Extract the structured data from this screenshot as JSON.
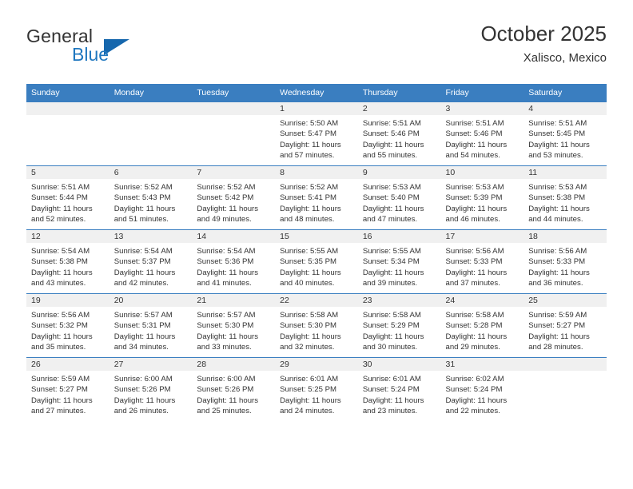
{
  "brand": {
    "name_part1": "General",
    "name_part2": "Blue",
    "logo_icon": "blue-triangle-logo"
  },
  "header": {
    "title": "October 2025",
    "subtitle": "Xalisco, Mexico"
  },
  "colors": {
    "header_blue": "#3a7ec0",
    "brand_blue": "#1f77bf",
    "day_band_grey": "#f0f0f0",
    "text": "#333333"
  },
  "weekdays": [
    "Sunday",
    "Monday",
    "Tuesday",
    "Wednesday",
    "Thursday",
    "Friday",
    "Saturday"
  ],
  "weeks": [
    [
      {
        "day": "",
        "sunrise": "",
        "sunset": "",
        "daylight1": "",
        "daylight2": "",
        "empty": true
      },
      {
        "day": "",
        "sunrise": "",
        "sunset": "",
        "daylight1": "",
        "daylight2": "",
        "empty": true
      },
      {
        "day": "",
        "sunrise": "",
        "sunset": "",
        "daylight1": "",
        "daylight2": "",
        "empty": true
      },
      {
        "day": "1",
        "sunrise": "Sunrise: 5:50 AM",
        "sunset": "Sunset: 5:47 PM",
        "daylight1": "Daylight: 11 hours",
        "daylight2": "and 57 minutes.",
        "empty": false
      },
      {
        "day": "2",
        "sunrise": "Sunrise: 5:51 AM",
        "sunset": "Sunset: 5:46 PM",
        "daylight1": "Daylight: 11 hours",
        "daylight2": "and 55 minutes.",
        "empty": false
      },
      {
        "day": "3",
        "sunrise": "Sunrise: 5:51 AM",
        "sunset": "Sunset: 5:46 PM",
        "daylight1": "Daylight: 11 hours",
        "daylight2": "and 54 minutes.",
        "empty": false
      },
      {
        "day": "4",
        "sunrise": "Sunrise: 5:51 AM",
        "sunset": "Sunset: 5:45 PM",
        "daylight1": "Daylight: 11 hours",
        "daylight2": "and 53 minutes.",
        "empty": false
      }
    ],
    [
      {
        "day": "5",
        "sunrise": "Sunrise: 5:51 AM",
        "sunset": "Sunset: 5:44 PM",
        "daylight1": "Daylight: 11 hours",
        "daylight2": "and 52 minutes.",
        "empty": false
      },
      {
        "day": "6",
        "sunrise": "Sunrise: 5:52 AM",
        "sunset": "Sunset: 5:43 PM",
        "daylight1": "Daylight: 11 hours",
        "daylight2": "and 51 minutes.",
        "empty": false
      },
      {
        "day": "7",
        "sunrise": "Sunrise: 5:52 AM",
        "sunset": "Sunset: 5:42 PM",
        "daylight1": "Daylight: 11 hours",
        "daylight2": "and 49 minutes.",
        "empty": false
      },
      {
        "day": "8",
        "sunrise": "Sunrise: 5:52 AM",
        "sunset": "Sunset: 5:41 PM",
        "daylight1": "Daylight: 11 hours",
        "daylight2": "and 48 minutes.",
        "empty": false
      },
      {
        "day": "9",
        "sunrise": "Sunrise: 5:53 AM",
        "sunset": "Sunset: 5:40 PM",
        "daylight1": "Daylight: 11 hours",
        "daylight2": "and 47 minutes.",
        "empty": false
      },
      {
        "day": "10",
        "sunrise": "Sunrise: 5:53 AM",
        "sunset": "Sunset: 5:39 PM",
        "daylight1": "Daylight: 11 hours",
        "daylight2": "and 46 minutes.",
        "empty": false
      },
      {
        "day": "11",
        "sunrise": "Sunrise: 5:53 AM",
        "sunset": "Sunset: 5:38 PM",
        "daylight1": "Daylight: 11 hours",
        "daylight2": "and 44 minutes.",
        "empty": false
      }
    ],
    [
      {
        "day": "12",
        "sunrise": "Sunrise: 5:54 AM",
        "sunset": "Sunset: 5:38 PM",
        "daylight1": "Daylight: 11 hours",
        "daylight2": "and 43 minutes.",
        "empty": false
      },
      {
        "day": "13",
        "sunrise": "Sunrise: 5:54 AM",
        "sunset": "Sunset: 5:37 PM",
        "daylight1": "Daylight: 11 hours",
        "daylight2": "and 42 minutes.",
        "empty": false
      },
      {
        "day": "14",
        "sunrise": "Sunrise: 5:54 AM",
        "sunset": "Sunset: 5:36 PM",
        "daylight1": "Daylight: 11 hours",
        "daylight2": "and 41 minutes.",
        "empty": false
      },
      {
        "day": "15",
        "sunrise": "Sunrise: 5:55 AM",
        "sunset": "Sunset: 5:35 PM",
        "daylight1": "Daylight: 11 hours",
        "daylight2": "and 40 minutes.",
        "empty": false
      },
      {
        "day": "16",
        "sunrise": "Sunrise: 5:55 AM",
        "sunset": "Sunset: 5:34 PM",
        "daylight1": "Daylight: 11 hours",
        "daylight2": "and 39 minutes.",
        "empty": false
      },
      {
        "day": "17",
        "sunrise": "Sunrise: 5:56 AM",
        "sunset": "Sunset: 5:33 PM",
        "daylight1": "Daylight: 11 hours",
        "daylight2": "and 37 minutes.",
        "empty": false
      },
      {
        "day": "18",
        "sunrise": "Sunrise: 5:56 AM",
        "sunset": "Sunset: 5:33 PM",
        "daylight1": "Daylight: 11 hours",
        "daylight2": "and 36 minutes.",
        "empty": false
      }
    ],
    [
      {
        "day": "19",
        "sunrise": "Sunrise: 5:56 AM",
        "sunset": "Sunset: 5:32 PM",
        "daylight1": "Daylight: 11 hours",
        "daylight2": "and 35 minutes.",
        "empty": false
      },
      {
        "day": "20",
        "sunrise": "Sunrise: 5:57 AM",
        "sunset": "Sunset: 5:31 PM",
        "daylight1": "Daylight: 11 hours",
        "daylight2": "and 34 minutes.",
        "empty": false
      },
      {
        "day": "21",
        "sunrise": "Sunrise: 5:57 AM",
        "sunset": "Sunset: 5:30 PM",
        "daylight1": "Daylight: 11 hours",
        "daylight2": "and 33 minutes.",
        "empty": false
      },
      {
        "day": "22",
        "sunrise": "Sunrise: 5:58 AM",
        "sunset": "Sunset: 5:30 PM",
        "daylight1": "Daylight: 11 hours",
        "daylight2": "and 32 minutes.",
        "empty": false
      },
      {
        "day": "23",
        "sunrise": "Sunrise: 5:58 AM",
        "sunset": "Sunset: 5:29 PM",
        "daylight1": "Daylight: 11 hours",
        "daylight2": "and 30 minutes.",
        "empty": false
      },
      {
        "day": "24",
        "sunrise": "Sunrise: 5:58 AM",
        "sunset": "Sunset: 5:28 PM",
        "daylight1": "Daylight: 11 hours",
        "daylight2": "and 29 minutes.",
        "empty": false
      },
      {
        "day": "25",
        "sunrise": "Sunrise: 5:59 AM",
        "sunset": "Sunset: 5:27 PM",
        "daylight1": "Daylight: 11 hours",
        "daylight2": "and 28 minutes.",
        "empty": false
      }
    ],
    [
      {
        "day": "26",
        "sunrise": "Sunrise: 5:59 AM",
        "sunset": "Sunset: 5:27 PM",
        "daylight1": "Daylight: 11 hours",
        "daylight2": "and 27 minutes.",
        "empty": false
      },
      {
        "day": "27",
        "sunrise": "Sunrise: 6:00 AM",
        "sunset": "Sunset: 5:26 PM",
        "daylight1": "Daylight: 11 hours",
        "daylight2": "and 26 minutes.",
        "empty": false
      },
      {
        "day": "28",
        "sunrise": "Sunrise: 6:00 AM",
        "sunset": "Sunset: 5:26 PM",
        "daylight1": "Daylight: 11 hours",
        "daylight2": "and 25 minutes.",
        "empty": false
      },
      {
        "day": "29",
        "sunrise": "Sunrise: 6:01 AM",
        "sunset": "Sunset: 5:25 PM",
        "daylight1": "Daylight: 11 hours",
        "daylight2": "and 24 minutes.",
        "empty": false
      },
      {
        "day": "30",
        "sunrise": "Sunrise: 6:01 AM",
        "sunset": "Sunset: 5:24 PM",
        "daylight1": "Daylight: 11 hours",
        "daylight2": "and 23 minutes.",
        "empty": false
      },
      {
        "day": "31",
        "sunrise": "Sunrise: 6:02 AM",
        "sunset": "Sunset: 5:24 PM",
        "daylight1": "Daylight: 11 hours",
        "daylight2": "and 22 minutes.",
        "empty": false
      },
      {
        "day": "",
        "sunrise": "",
        "sunset": "",
        "daylight1": "",
        "daylight2": "",
        "empty": true
      }
    ]
  ]
}
